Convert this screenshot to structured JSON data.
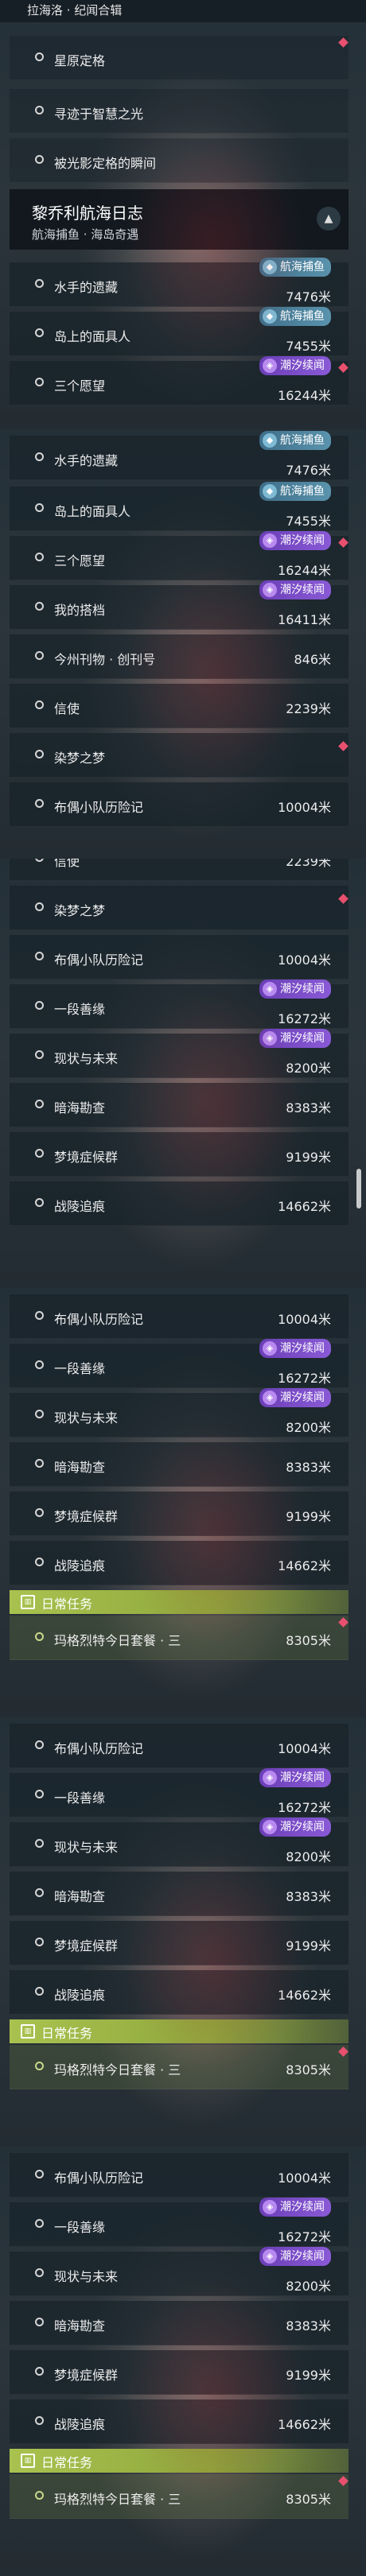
{
  "topbar": {
    "title": "拉海洛 · 纪闻合辑"
  },
  "section": {
    "title": "黎乔利航海日志",
    "subtitle": "航海捕鱼 · 海岛奇遇",
    "toggle": "▲"
  },
  "daily": {
    "label": "日常任务"
  },
  "badges": {
    "tide": "潮汐续闻",
    "fish": "航海捕鱼"
  },
  "items": {
    "xingyuan": "星原定格",
    "zhihui": "寻迹于智慧之光",
    "guangying": "被光影定格的瞬间",
    "shuishou": "水手的遗藏",
    "daoshang": "岛上的面具人",
    "sange": "三个愿望",
    "dapa": "我的搭档",
    "jinzhou": "今州刊物 · 创刊号",
    "xinshi": "信使",
    "ranshao": "染梦之梦",
    "buou": "布偶小队历险记",
    "yiduan": "一段善缘",
    "xianzhuang": "现状与未来",
    "anhai": "暗海勘查",
    "mengjing": "梦境症候群",
    "zhanling": "战陵追痕",
    "mage": "玛格烈特今日套餐 · 三"
  },
  "dist": {
    "shuishou": "7476米",
    "daoshang": "7455米",
    "sange": "16244米",
    "dapa": "16411米",
    "jinzhou": "846米",
    "xinshi": "2239米",
    "buou": "10004米",
    "yiduan": "16272米",
    "xianzhuang": "8200米",
    "anhai": "8383米",
    "mengjing": "9199米",
    "zhanling": "14662米",
    "mage": "8305米"
  }
}
